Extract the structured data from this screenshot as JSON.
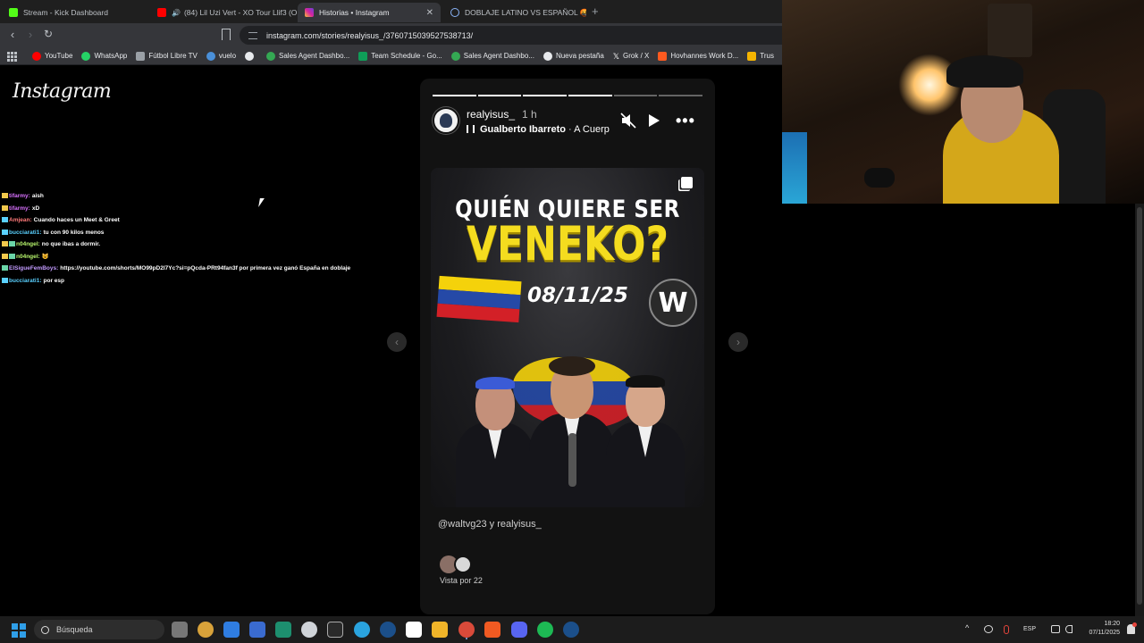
{
  "tabs": [
    {
      "title": "Stream - Kick Dashboard",
      "favicon_color": "#53fc18",
      "active": false
    },
    {
      "title": "(84) Lil Uzi Vert - XO Tour Llif3 (O",
      "favicon_color": "#ff0000",
      "active": false
    },
    {
      "title": "Historias • Instagram",
      "favicon_color": "#d6249f",
      "active": true
    },
    {
      "title": "DOBLAJE LATINO VS ESPAÑOL 🤬 I",
      "favicon_color": "#8ab4f8",
      "active": false
    }
  ],
  "address_bar": {
    "url": "instagram.com/stories/realyisus_/3760715039527538713/"
  },
  "bookmarks": [
    {
      "label": "YouTube",
      "color": "#ff0000"
    },
    {
      "label": "WhatsApp",
      "color": "#25d366"
    },
    {
      "label": "Fútbol Libre TV",
      "color": "#9aa0a6"
    },
    {
      "label": "vuelo",
      "color": "#4a90d9"
    },
    {
      "label": "",
      "color": "#e8eaed"
    },
    {
      "label": "Sales Agent Dashbo...",
      "color": "#34a853"
    },
    {
      "label": "Team Schedule - Go...",
      "color": "#0f9d58"
    },
    {
      "label": "Sales Agent Dashbo...",
      "color": "#34a853"
    },
    {
      "label": "Nueva pestaña",
      "color": "#e8eaed"
    },
    {
      "label": "Grok / X",
      "color": "#e8eaed"
    },
    {
      "label": "Hovhannes Work D...",
      "color": "#ff5a1f"
    },
    {
      "label": "Trus",
      "color": "#f5b400"
    }
  ],
  "instagram": {
    "logo": "Instagram"
  },
  "chat": [
    {
      "user": "tifarmy:",
      "message": "aish",
      "color": "#d971ff"
    },
    {
      "user": "tifarmy:",
      "message": "xD",
      "color": "#d971ff"
    },
    {
      "user": "Amjean:",
      "message": "Cuando haces un Meet & Greet",
      "color": "#ff7a7a"
    },
    {
      "user": "bucciarati1:",
      "message": "tu con 90 kilos menos",
      "color": "#5ad1ff"
    },
    {
      "user": "n04ngel:",
      "message": "no que ibas a dormir.",
      "color": "#b7f56c"
    },
    {
      "user": "n04ngel:",
      "message": "😺",
      "color": "#b7f56c"
    },
    {
      "user": "ElSigueFemBoys:",
      "message": "https://youtube.com/shorts/MO99pD2l7Yc?si=pQcda-PRt94fan3f por primera vez ganó España en doblaje",
      "color": "#c39bff"
    },
    {
      "user": "bucciarati1:",
      "message": "por esp",
      "color": "#5ad1ff"
    }
  ],
  "story": {
    "username": "realyisus_",
    "time": "1 h",
    "music_artist": "Gualberto Ibarreto",
    "music_song": "A Cuerp",
    "progress_total": 6,
    "progress_done": 4,
    "poster": {
      "title_line1": "QUIÉN QUIERE SER",
      "title_line2": "VENEKO?",
      "date": "08/11/25",
      "logo_letter": "W"
    },
    "mentions": "@waltvg23 y realyisus_",
    "views": "Vista por 22"
  },
  "taskbar": {
    "search_placeholder": "Búsqueda",
    "language": "ESP",
    "time": "18:20",
    "date": "07/11/2025"
  }
}
